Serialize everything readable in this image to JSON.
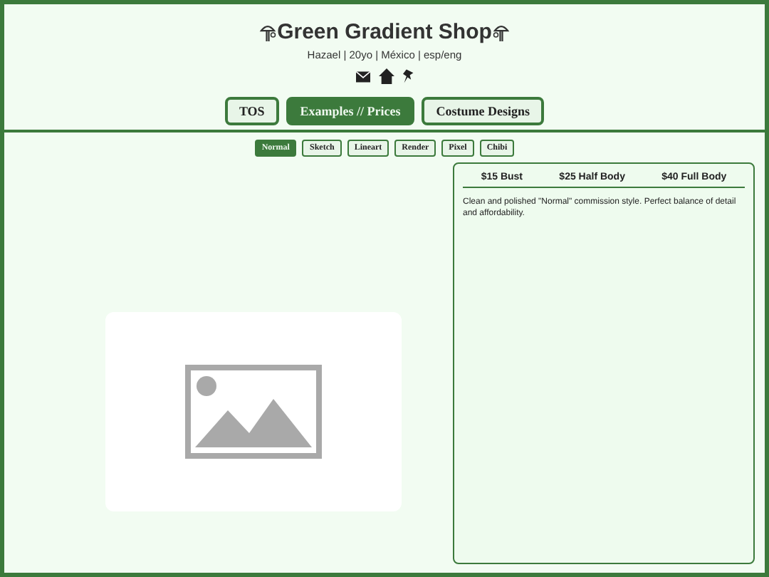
{
  "header": {
    "title": "Green Gradient Shop",
    "subtitle": "Hazael | 20yo | México | esp/eng"
  },
  "tabs": [
    {
      "label": "TOS",
      "selected": false
    },
    {
      "label": "Examples // Prices",
      "selected": true
    },
    {
      "label": "Costume Designs",
      "selected": false
    }
  ],
  "styles": [
    {
      "label": "Normal",
      "selected": true
    },
    {
      "label": "Sketch",
      "selected": false
    },
    {
      "label": "Lineart",
      "selected": false
    },
    {
      "label": "Render",
      "selected": false
    },
    {
      "label": "Pixel",
      "selected": false
    },
    {
      "label": "Chibi",
      "selected": false
    }
  ],
  "prices": [
    "$15 Bust",
    "$25 Half Body",
    "$40 Full Body"
  ],
  "description": "Clean and polished \"Normal\" commission style. Perfect balance of detail and affordability."
}
